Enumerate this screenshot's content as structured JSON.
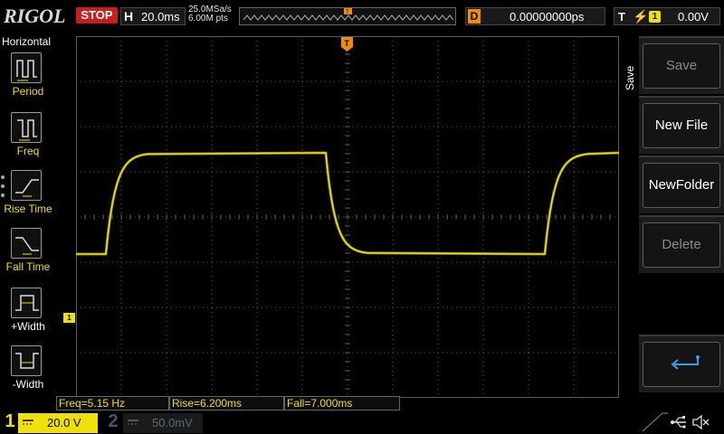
{
  "topbar": {
    "logo": "RIGOL",
    "run_state": "STOP",
    "horizontal_label": "H",
    "timebase": "20.0ms",
    "sample_rate": "25.0MSa/s",
    "memory_depth": "6.00M pts",
    "delay_label": "D",
    "delay_value": "0.00000000ps",
    "trigger_label": "T",
    "trigger_source": "1",
    "trigger_level": "0.00V",
    "trigger_edge_icon": "rising-edge-icon"
  },
  "left_menu": {
    "title": "Horizontal",
    "items": [
      {
        "label": "Period",
        "icon": "period-icon",
        "active": false
      },
      {
        "label": "Freq",
        "icon": "frequency-icon",
        "active": false
      },
      {
        "label": "Rise Time",
        "icon": "rise-time-icon",
        "active": false
      },
      {
        "label": "Fall Time",
        "icon": "fall-time-icon",
        "active": false
      },
      {
        "label": "+Width",
        "icon": "positive-width-icon",
        "active": true
      },
      {
        "label": "-Width",
        "icon": "negative-width-icon",
        "active": true
      }
    ]
  },
  "right_menu": {
    "title": "Save",
    "softkeys": [
      {
        "label": "Save",
        "enabled": false
      },
      {
        "label": "New File",
        "enabled": true
      },
      {
        "label": "NewFolder",
        "enabled": true
      },
      {
        "label": "Delete",
        "enabled": false
      },
      {
        "label": "",
        "icon": "return-icon",
        "enabled": true
      }
    ]
  },
  "measurements": [
    {
      "label": "Freq=5.15 Hz"
    },
    {
      "label": "Rise=6.200ms"
    },
    {
      "label": "Fall=7.000ms"
    }
  ],
  "channels": [
    {
      "number": "1",
      "scale": "20.0 V",
      "active": true,
      "color": "#f0e000"
    },
    {
      "number": "2",
      "scale": "50.0mV",
      "active": false,
      "color": "#3a5a70"
    }
  ],
  "markers": {
    "ch1_ground": "1",
    "trigger_position": "T",
    "trigger_level": "T"
  },
  "status_icons": [
    "usb-icon",
    "sound-muted-icon"
  ],
  "colors": {
    "ch1": "#f0e000",
    "trigger": "#f08c00",
    "stop": "#c81e1e",
    "grid": "#5a5a5a"
  }
}
